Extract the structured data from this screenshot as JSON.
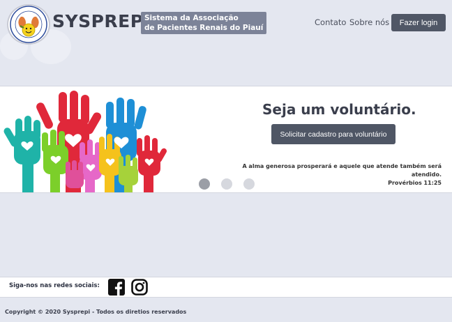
{
  "header": {
    "brand": "SYSPREPI",
    "tagline_line1": "Sistema da Associação",
    "tagline_line2": "de Pacientes Renais do Piauí",
    "nav": [
      {
        "label": "Contato"
      },
      {
        "label": "Sobre nós"
      }
    ],
    "login_label": "Fazer login"
  },
  "banner": {
    "headline": "Seja um voluntário.",
    "cta_label": "Solicitar cadastro para voluntário",
    "quote_text": "A alma generosa prosperará e aquele que atende também será atendido.",
    "quote_source": "Provérbios 11:25",
    "carousel": {
      "total": 3,
      "active": 1
    }
  },
  "footer": {
    "social_label": "Siga-nos nas redes sociais:",
    "social_icons": [
      "facebook-icon",
      "instagram-icon"
    ],
    "copyright": "Copyright © 2020 Sysprepi - Todos os diretios reservados"
  },
  "colors": {
    "background": "#e4e7f0",
    "button": "#505766",
    "tagline_bg": "#7c8398"
  }
}
